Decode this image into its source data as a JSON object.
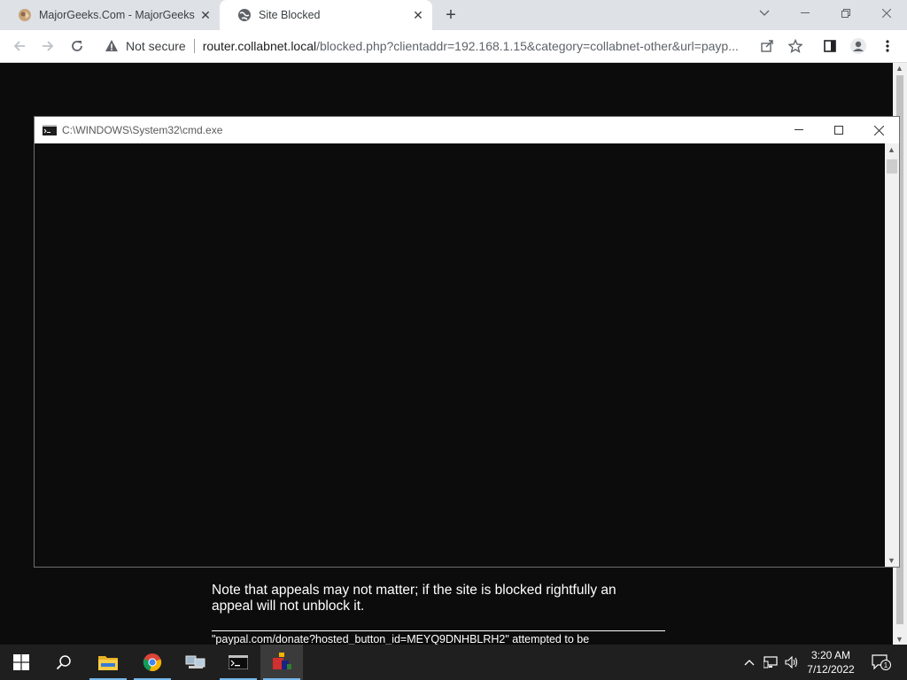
{
  "browser": {
    "tabs": [
      {
        "title": "MajorGeeks.Com - MajorGeeks",
        "active": false
      },
      {
        "title": "Site Blocked",
        "active": true
      }
    ],
    "address": {
      "security_label": "Not secure",
      "url_host": "router.collabnet.local",
      "url_rest": "/blocked.php?clientaddr=192.168.1.15&category=collabnet-other&url=payp..."
    }
  },
  "page": {
    "appeal_note": "Note that appeals may not matter; if the site is blocked rightfully an appeal will not unblock it.",
    "blocked_line": "\"paypal.com/donate?hosted_button_id=MEYQ9DNHBLRH2\" attempted to be"
  },
  "cmd_window": {
    "title": "C:\\WINDOWS\\System32\\cmd.exe"
  },
  "taskbar": {
    "clock_time": "3:20 AM",
    "clock_date": "7/12/2022",
    "notification_count": "1"
  }
}
